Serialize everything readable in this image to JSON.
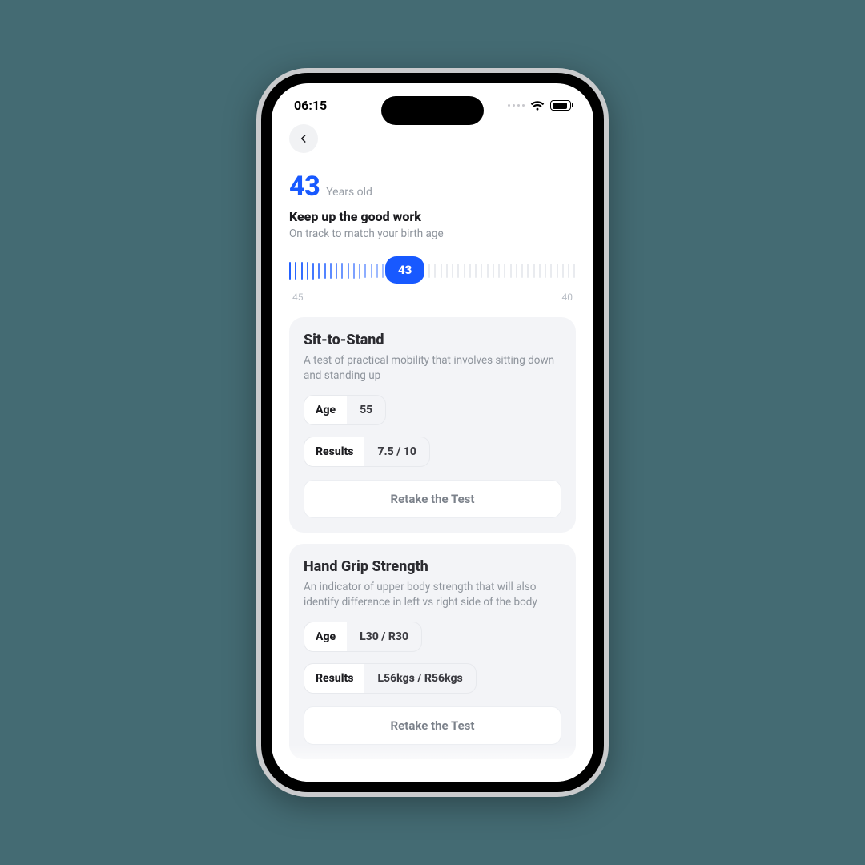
{
  "status_bar": {
    "time": "06:15"
  },
  "hero": {
    "age_number": "43",
    "age_label": "Years old",
    "headline": "Keep up the good work",
    "subline": "On track to match your birth age",
    "bubble": "43",
    "scale_left": "45",
    "scale_right": "40"
  },
  "cards": {
    "sit_to_stand": {
      "title": "Sit-to-Stand",
      "desc": "A test of practical mobility that involves sitting down and standing up",
      "age_label": "Age",
      "age_value": "55",
      "results_label": "Results",
      "results_value": "7.5 / 10",
      "retake": "Retake the Test"
    },
    "hand_grip": {
      "title": "Hand Grip Strength",
      "desc": "An indicator of upper body strength that will also identify difference in left vs right side of the body",
      "age_label": "Age",
      "age_value": "L30 / R30",
      "results_label": "Results",
      "results_value": "L56kgs / R56kgs",
      "retake": "Retake the Test"
    }
  }
}
